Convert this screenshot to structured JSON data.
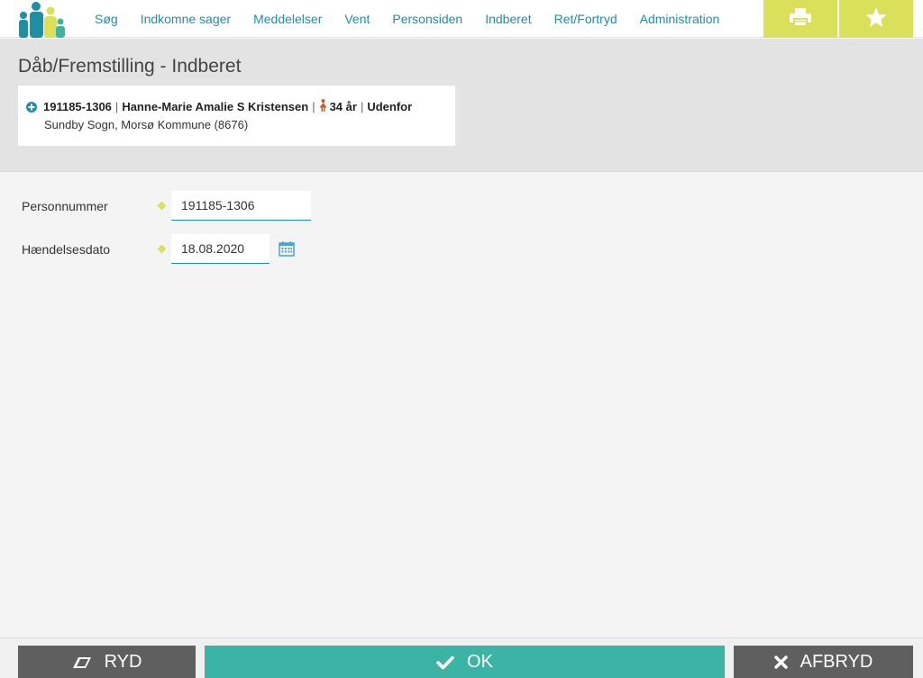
{
  "nav": {
    "items": [
      "Søg",
      "Indkomne sager",
      "Meddelelser",
      "Vent",
      "Personsiden",
      "Indberet",
      "Ret/Fortryd",
      "Administration"
    ]
  },
  "icons": {
    "logo": "family-logo",
    "print": "print-icon",
    "star": "star-icon",
    "expand": "plus-circle-icon",
    "gender": "female-icon",
    "calendar": "calendar-icon",
    "eraser": "eraser-icon",
    "check": "check-icon",
    "close": "close-icon"
  },
  "colors": {
    "accent": "#1f8fa6",
    "toolbar_button": "#dbe05a",
    "ok_button": "#3bb3a5",
    "secondary_button": "#5f5f5f",
    "gender_icon": "#d9531e"
  },
  "page": {
    "title": "Dåb/Fremstilling - Indberet"
  },
  "person": {
    "cpr": "191185-1306",
    "separator": "|",
    "name": "Hanne-Marie Amalie S Kristensen",
    "age": "34 år",
    "status": "Udenfor",
    "location": "Sundby Sogn, Morsø Kommune (8676)"
  },
  "form": {
    "personnummer_label": "Personnummer",
    "personnummer_value": "191185-1306",
    "haendelsesdato_label": "Hændelsesdato",
    "haendelsesdato_value": "18.08.2020"
  },
  "footer": {
    "ryd_label": "RYD",
    "ok_label": "OK",
    "afbryd_label": "AFBRYD"
  }
}
